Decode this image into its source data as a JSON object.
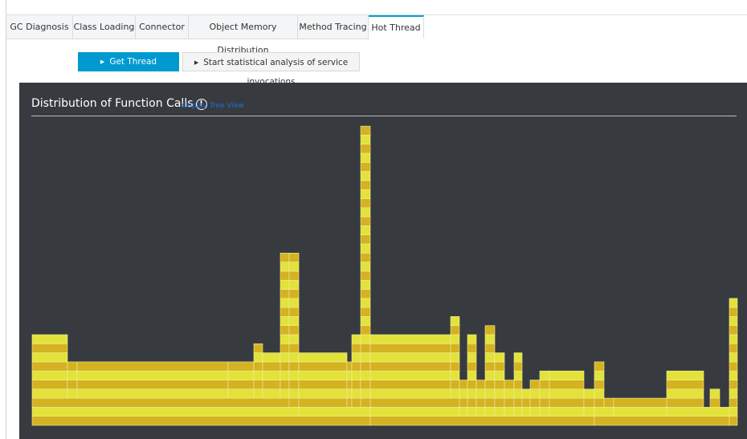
{
  "tabs": [
    {
      "label": "GC Diagnosis",
      "active": false
    },
    {
      "label": "Class Loading",
      "active": false
    },
    {
      "label": "Connector",
      "active": false
    },
    {
      "label": "Object Memory Distribution",
      "active": false
    },
    {
      "label": "Method Tracing",
      "active": false
    },
    {
      "label": "Hot Thread",
      "active": true
    }
  ],
  "actions": {
    "snapshot_label": "Get Thread Snapshots",
    "analysis_label": "Start statistical analysis of service invocations"
  },
  "panel": {
    "title": "Distribution of Function Calls",
    "info_icon": "info-circle-icon",
    "tree_view_link": "display Tree View"
  },
  "colors": {
    "accent": "#00a2ca",
    "primary_button": "#0099d0",
    "panel_bg": "#373b40",
    "frame_light": "#e2e23a",
    "frame_dark": "#d4b222"
  }
}
